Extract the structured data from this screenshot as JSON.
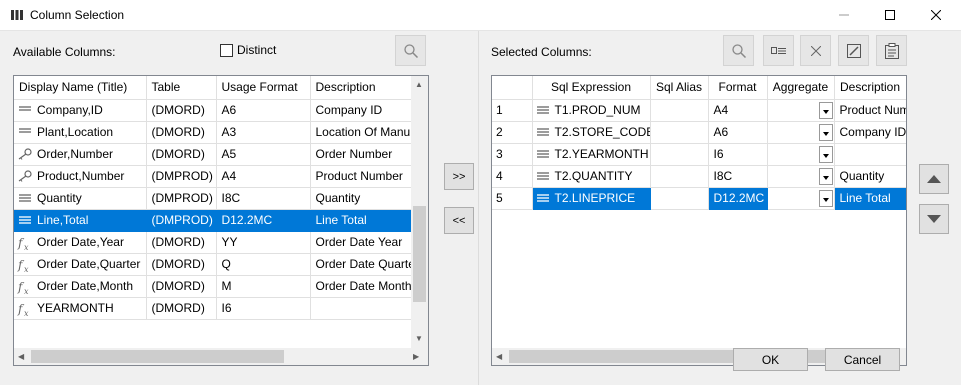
{
  "window": {
    "title": "Column Selection",
    "icon": "columns-icon"
  },
  "available": {
    "label": "Available Columns:",
    "distinct_label": "Distinct",
    "distinct_checked": false,
    "columns": [
      "Display Name (Title)",
      "Table",
      "Usage Format",
      "Description"
    ],
    "rows": [
      {
        "icon": "dimension-icon",
        "name": "Company,ID",
        "table": "(DMORD)",
        "format": "A6",
        "desc": "Company ID"
      },
      {
        "icon": "dimension-icon",
        "name": "Plant,Location",
        "table": "(DMORD)",
        "format": "A3",
        "desc": "Location Of Manu"
      },
      {
        "icon": "key-icon",
        "name": "Order,Number",
        "table": "(DMORD)",
        "format": "A5",
        "desc": "Order Number"
      },
      {
        "icon": "key-icon",
        "name": "Product,Number",
        "table": "(DMPROD)",
        "format": "A4",
        "desc": "Product Number"
      },
      {
        "icon": "measure-icon",
        "name": "Quantity",
        "table": "(DMPROD)",
        "format": "I8C",
        "desc": "Quantity"
      },
      {
        "icon": "measure-icon",
        "name": "Line,Total",
        "table": "(DMPROD)",
        "format": "D12.2MC",
        "desc": "Line Total",
        "selected": true
      },
      {
        "icon": "function-icon",
        "name": "Order Date,Year",
        "table": "(DMORD)",
        "format": "YY",
        "desc": "Order Date Year"
      },
      {
        "icon": "function-icon",
        "name": "Order Date,Quarter",
        "table": "(DMORD)",
        "format": "Q",
        "desc": "Order Date Quarte"
      },
      {
        "icon": "function-icon",
        "name": "Order Date,Month",
        "table": "(DMORD)",
        "format": "M",
        "desc": "Order Date Month"
      },
      {
        "icon": "function-icon",
        "name": "YEARMONTH",
        "table": "(DMORD)",
        "format": "I6",
        "desc": ""
      }
    ]
  },
  "transfer": {
    "add_label": ">>",
    "remove_label": "<<"
  },
  "selected": {
    "label": "Selected Columns:",
    "columns": [
      "",
      "Sql Expression",
      "Sql Alias",
      "Format",
      "Aggregate",
      "Description"
    ],
    "rows": [
      {
        "num": "1",
        "expr": "T1.PROD_NUM",
        "alias": "",
        "format": "A4",
        "aggregate": "",
        "desc": "Product Num"
      },
      {
        "num": "2",
        "expr": "T2.STORE_CODE",
        "alias": "",
        "format": "A6",
        "aggregate": "",
        "desc": "Company ID"
      },
      {
        "num": "3",
        "expr": "T2.YEARMONTH",
        "alias": "",
        "format": "I6",
        "aggregate": "",
        "desc": ""
      },
      {
        "num": "4",
        "expr": "T2.QUANTITY",
        "alias": "",
        "format": "I8C",
        "aggregate": "",
        "desc": "Quantity"
      },
      {
        "num": "5",
        "expr": "T2.LINEPRICE",
        "alias": "",
        "format": "D12.2MC",
        "aggregate": "",
        "desc": "Line Total",
        "selected": true
      }
    ]
  },
  "buttons": {
    "ok": "OK",
    "cancel": "Cancel"
  },
  "colors": {
    "selection": "#0078d7",
    "window_bg": "#f0f0f0"
  }
}
